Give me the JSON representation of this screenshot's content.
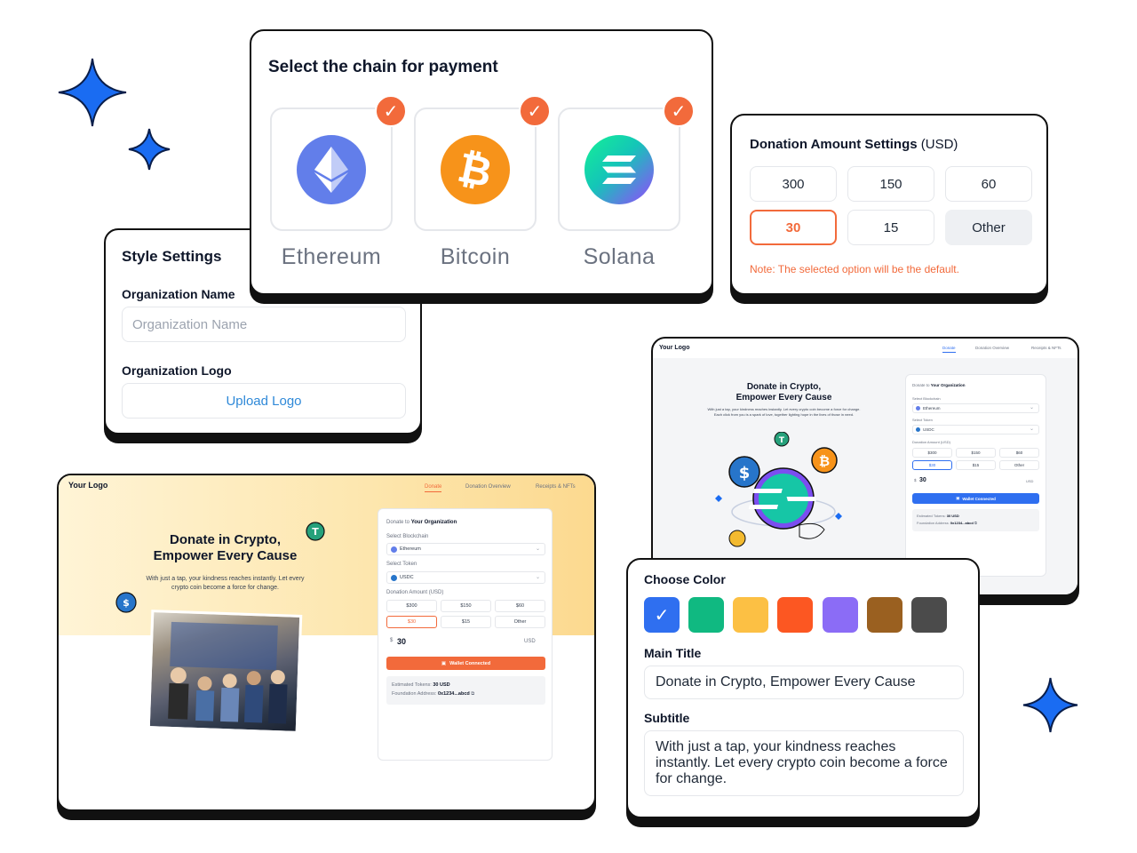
{
  "chain_card": {
    "title": "Select the chain for payment",
    "options": [
      {
        "name": "Ethereum",
        "icon": "ethereum-icon",
        "selected": true,
        "color": "#627eea"
      },
      {
        "name": "Bitcoin",
        "icon": "bitcoin-icon",
        "selected": true,
        "color": "#f7931a"
      },
      {
        "name": "Solana",
        "icon": "solana-icon",
        "selected": true,
        "color": "#9945ff"
      }
    ],
    "check_color": "#f26a3b"
  },
  "amount_card": {
    "title": "Donation Amount Settings",
    "currency": "(USD)",
    "amounts": [
      "300",
      "150",
      "60",
      "30",
      "15",
      "Other"
    ],
    "selected": "30",
    "note": "Note: The selected option will be the default."
  },
  "style_card": {
    "title": "Style Settings",
    "org_name_label": "Organization Name",
    "org_name_placeholder": "Organization Name",
    "org_logo_label": "Organization Logo",
    "upload_button": "Upload Logo"
  },
  "preview": {
    "logo": "Your Logo",
    "nav": [
      "Donate",
      "Donation Overview",
      "Receipts & NFTs"
    ],
    "heading_line1": "Donate in Crypto,",
    "heading_line2": "Empower Every Cause",
    "subtitle_line1": "With just a tap, your kindness reaches instantly. Let every",
    "subtitle_line2": "crypto coin become a force for change.",
    "small_subtitle_line1": "With just a tap, your kindness reaches instantly. Let every crypto coin become a force for change.",
    "small_subtitle_line2": "Each click from you is a spark of love, together lighting hope in the lives of those in need.",
    "donate_to_prefix": "Donate to",
    "donate_to_org": "Your Organization",
    "select_blockchain_label": "Select Blockchain",
    "blockchain_value": "Ethereum",
    "select_token_label": "Select Token",
    "token_value": "USDC",
    "amount_label": "Donation Amount (USD)",
    "amounts": [
      "$300",
      "$150",
      "$60",
      "$30",
      "$15",
      "Other"
    ],
    "currency_symbol": "$",
    "amount_value": "30",
    "currency_code": "USD",
    "wallet_button": "Wallet Connected",
    "estimated_label": "Estimated Tokens:",
    "estimated_value": "30 USD",
    "foundation_label": "Foundation Address:",
    "foundation_value": "0x1234...abcd",
    "accent": "#f26a3b",
    "small_button_color": "#2f6ff0"
  },
  "color_card": {
    "title": "Choose Color",
    "swatches": [
      "#2f6ff0",
      "#10b981",
      "#fcc044",
      "#fc5722",
      "#8b6cf6",
      "#9a6020",
      "#4b4b4b"
    ],
    "main_title_label": "Main Title",
    "main_title_value": "Donate in Crypto, Empower Every Cause",
    "subtitle_label": "Subtitle",
    "subtitle_value": "With just a tap, your kindness reaches instantly. Let every crypto coin become a force for change."
  },
  "sparkle_color": "#1a6cf2"
}
